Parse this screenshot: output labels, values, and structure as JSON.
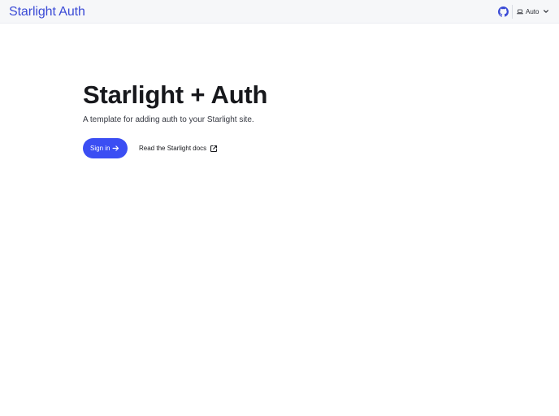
{
  "header": {
    "site_title": "Starlight Auth",
    "github_icon": "github-icon",
    "theme_select": {
      "icon": "laptop-icon",
      "value": "Auto",
      "chevron_icon": "chevron-down-icon"
    }
  },
  "hero": {
    "title": "Starlight + Auth",
    "tagline": "A template for adding auth to your Starlight site.",
    "primary_action": {
      "label": "Sign in",
      "icon": "arrow-right-icon"
    },
    "secondary_action": {
      "label": "Read the Starlight docs",
      "icon": "external-link-icon"
    }
  },
  "colors": {
    "accent": "#3b4ef3",
    "title_accent": "#3b4bd6",
    "header_bg": "#f6f7f9",
    "text": "#17181c"
  }
}
